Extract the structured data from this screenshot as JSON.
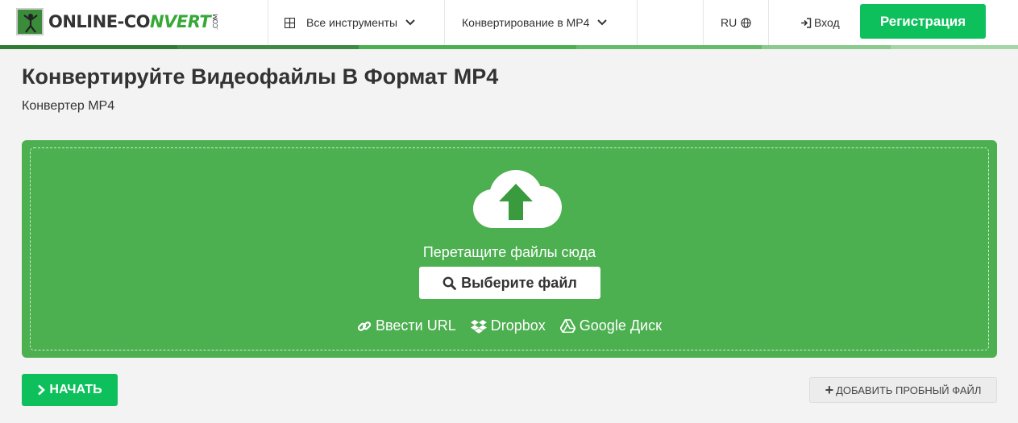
{
  "header": {
    "logo": {
      "part1": "ONLINE-CO",
      "part2": "NVERT",
      "tld": ".COM"
    },
    "nav": {
      "all_tools": "Все инструменты",
      "convert_mp4": "Конвертирование в MP4",
      "lang": "RU",
      "login": "Вход",
      "register": "Регистрация"
    }
  },
  "page": {
    "title": "Конвертируйте Видеофайлы В Формат MP4",
    "subtitle": "Конвертер MP4"
  },
  "upload": {
    "drop_text": "Перетащите файлы сюда",
    "choose_file": "Выберите файл",
    "sources": {
      "url": "Ввести URL",
      "dropbox": "Dropbox",
      "gdrive": "Google Диск"
    }
  },
  "actions": {
    "start": "НАЧАТЬ",
    "add_sample": "ДОБАВИТЬ ПРОБНЫЙ ФАЙЛ"
  },
  "colors": {
    "accent_green": "#0ec05c",
    "upload_bg": "#4caf50",
    "progress_segments": [
      "#2e7d32",
      "#3d8b40",
      "#4caf50",
      "#66bb6a",
      "#8bc98d",
      "#a5d6a7"
    ]
  },
  "icons": {
    "grid": "grid-icon",
    "chevron": "chevron-down-icon",
    "globe": "globe-icon",
    "login": "sign-in-icon",
    "cloud": "cloud-upload-icon",
    "search": "search-icon",
    "link": "link-icon",
    "dropbox": "dropbox-icon",
    "gdrive": "google-drive-icon",
    "start": "chevron-right-icon",
    "plus": "plus-icon"
  }
}
